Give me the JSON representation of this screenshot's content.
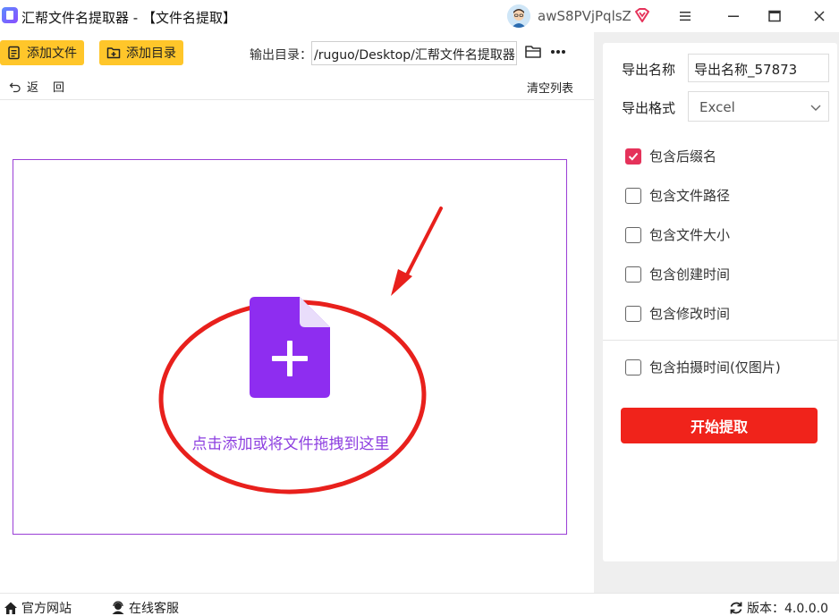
{
  "window": {
    "title": "汇帮文件名提取器 - 【文件名提取】",
    "username": "awS8PVjPqlsZ"
  },
  "toolbar": {
    "add_file_label": "添加文件",
    "add_dir_label": "添加目录",
    "output_dir_label": "输出目录：",
    "output_dir_value": "/ruguo/Desktop/汇帮文件名提取器",
    "back_label_1": "返",
    "back_label_2": "回",
    "clear_list_label": "清空列表"
  },
  "dropzone": {
    "hint": "点击添加或将文件拖拽到这里"
  },
  "settings": {
    "export_name_label": "导出名称",
    "export_name_value": "导出名称_57873",
    "export_format_label": "导出格式",
    "export_format_value": "Excel",
    "options": [
      {
        "label": "包含后缀名",
        "checked": true
      },
      {
        "label": "包含文件路径",
        "checked": false
      },
      {
        "label": "包含文件大小",
        "checked": false
      },
      {
        "label": "包含创建时间",
        "checked": false
      },
      {
        "label": "包含修改时间",
        "checked": false
      },
      {
        "label": "包含拍摄时间(仅图片)",
        "checked": false
      }
    ],
    "start_label": "开始提取"
  },
  "statusbar": {
    "website_label": "官方网站",
    "support_label": "在线客服",
    "version_label": "版本：4.0.0.0"
  },
  "colors": {
    "accent_yellow": "#ffc62a",
    "start_red": "#f0231b",
    "checkbox_pink": "#e5325a",
    "drop_purple": "#8d3fe0",
    "annotation_red": "#e8201c"
  }
}
